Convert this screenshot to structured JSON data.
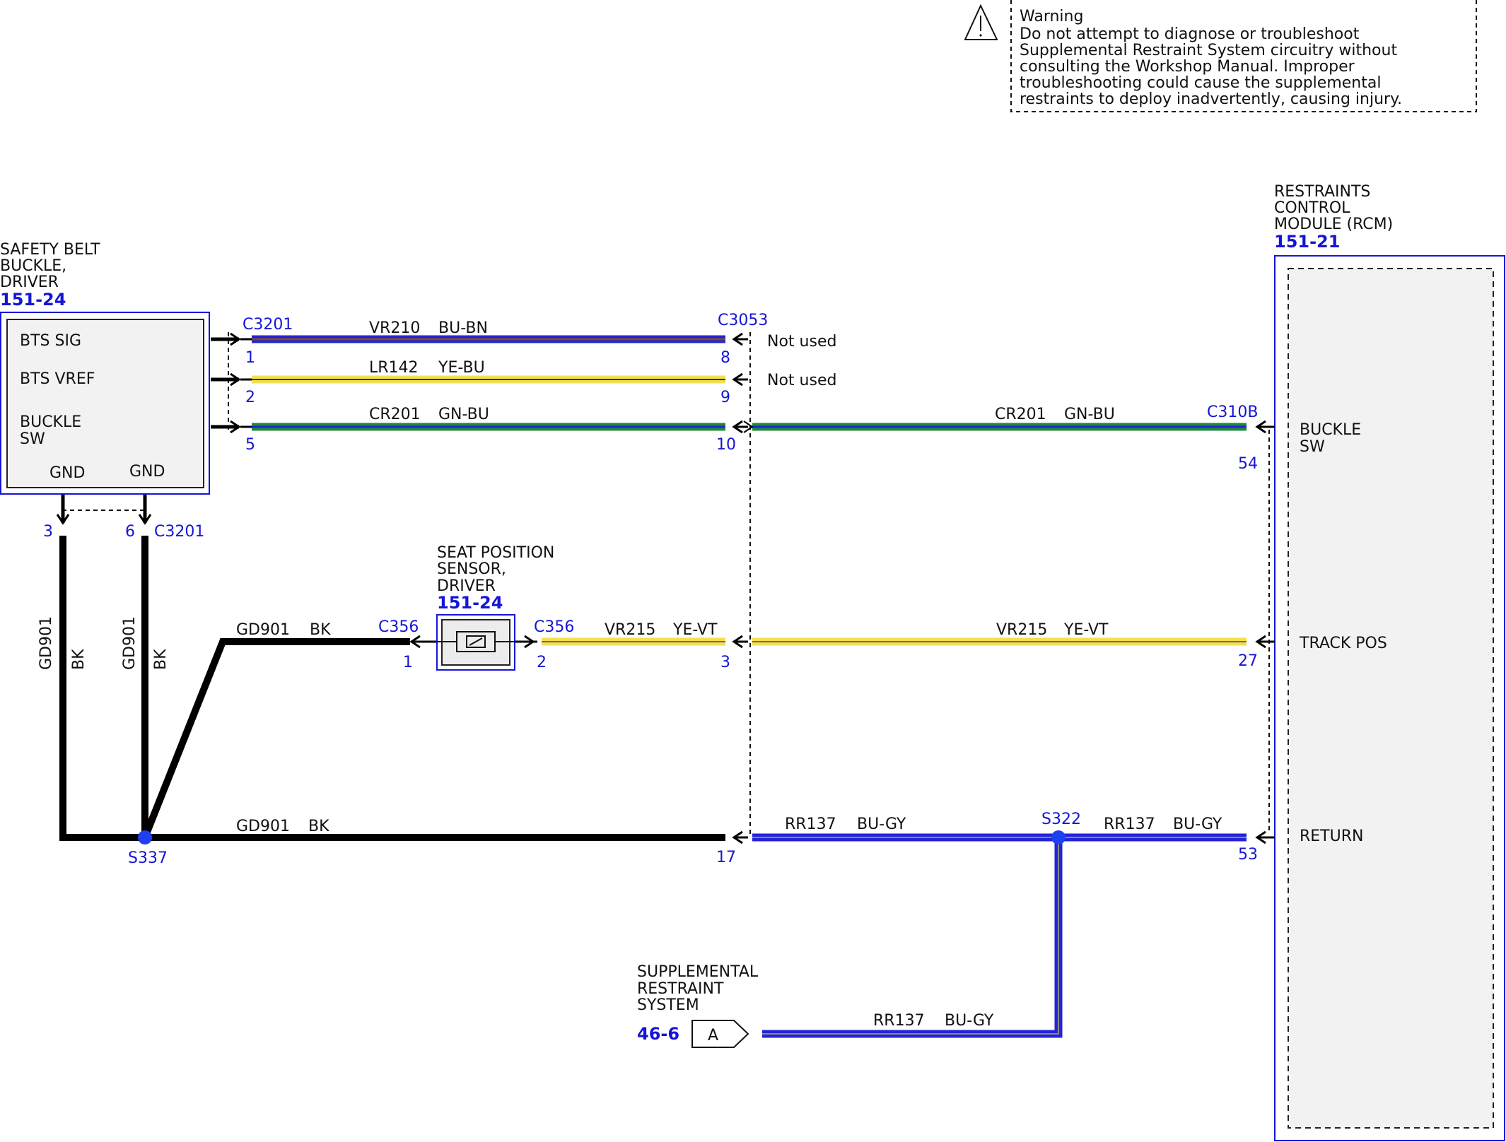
{
  "warning": {
    "title": "Warning",
    "lines": [
      "Do not attempt to diagnose or troubleshoot",
      "Supplemental Restraint System circuitry without",
      "consulting the Workshop Manual. Improper",
      "troubleshooting could cause the supplemental",
      "restraints to deploy inadvertently, causing injury."
    ]
  },
  "buckle": {
    "title_lines": [
      "SAFETY BELT",
      "BUCKLE,",
      "DRIVER"
    ],
    "ref": "151-24",
    "pins": {
      "bts_sig": "BTS SIG",
      "bts_vref": "BTS VREF",
      "buckle_sw_1": "BUCKLE",
      "buckle_sw_2": "SW",
      "gnd_a": "GND",
      "gnd_b": "GND"
    }
  },
  "rcm": {
    "title_lines": [
      "RESTRAINTS",
      "CONTROL",
      "MODULE (RCM)"
    ],
    "ref": "151-21",
    "pins": {
      "buckle_sw_1": "BUCKLE",
      "buckle_sw_2": "SW",
      "track_pos": "TRACK POS",
      "return": "RETURN"
    }
  },
  "seat_sensor": {
    "title_lines": [
      "SEAT POSITION",
      "SENSOR,",
      "DRIVER"
    ],
    "ref": "151-24"
  },
  "srs": {
    "title_lines": [
      "SUPPLEMENTAL",
      "RESTRAINT",
      "SYSTEM"
    ],
    "ref": "46-6",
    "tag": "A"
  },
  "connectors": {
    "c3201": "C3201",
    "c3053": "C3053",
    "c310b": "C310B",
    "c356": "C356"
  },
  "splices": {
    "s337": "S337",
    "s322": "S322"
  },
  "pins": {
    "p1": "1",
    "p2": "2",
    "p5": "5",
    "p3": "3",
    "p6": "6",
    "p8": "8",
    "p9": "9",
    "p10": "10",
    "p17": "17",
    "p54": "54",
    "p27": "27",
    "p53": "53",
    "c356_1": "1",
    "c356_2": "2",
    "c3053_3": "3"
  },
  "notes": {
    "not_used": "Not used"
  },
  "wires": {
    "vr210": {
      "circuit": "VR210",
      "color": "BU-BN"
    },
    "lr142": {
      "circuit": "LR142",
      "color": "YE-BU"
    },
    "cr201": {
      "circuit": "CR201",
      "color": "GN-BU"
    },
    "gd901": {
      "circuit": "GD901",
      "color": "BK"
    },
    "vr215": {
      "circuit": "VR215",
      "color": "YE-VT"
    },
    "rr137": {
      "circuit": "RR137",
      "color": "BU-GY"
    }
  },
  "colors": {
    "blue": "#2323d8",
    "brown": "#7a4a2a",
    "yellow": "#f2e24a",
    "green": "#1e8a3a",
    "black": "#000000",
    "label_blue": "#1515d8"
  }
}
